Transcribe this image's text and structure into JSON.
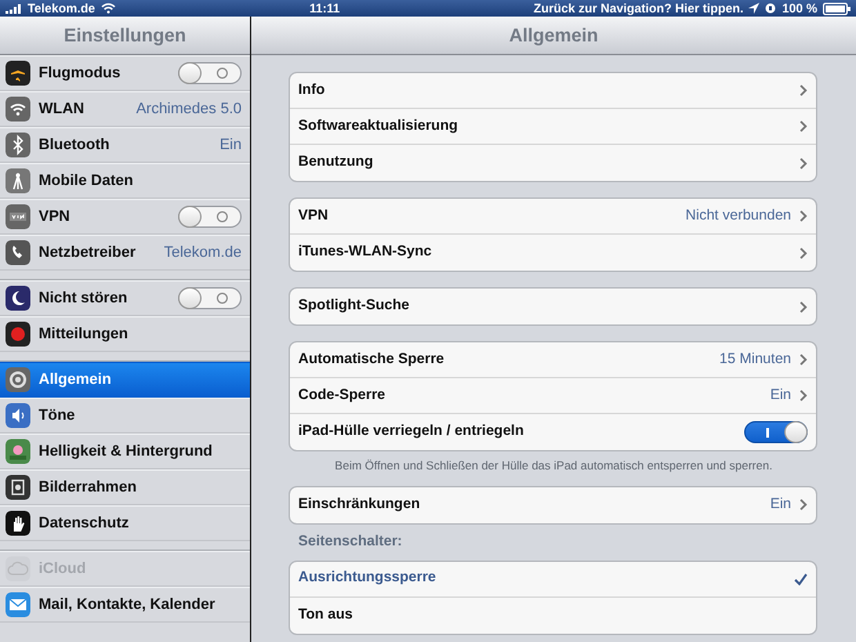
{
  "status_bar": {
    "carrier": "Telekom.de",
    "time": "11:11",
    "back_hint": "Zurück zur Navigation? Hier tippen.",
    "battery": "100 %"
  },
  "sidebar": {
    "title": "Einstellungen",
    "groups": [
      [
        {
          "label": "Flugmodus",
          "kind": "toggle",
          "on": false,
          "selected": false,
          "disabled": false
        },
        {
          "label": "WLAN",
          "kind": "value",
          "value": "Archimedes 5.0",
          "selected": false,
          "disabled": false
        },
        {
          "label": "Bluetooth",
          "kind": "value",
          "value": "Ein",
          "selected": false,
          "disabled": false
        },
        {
          "label": "Mobile Daten",
          "kind": "plain",
          "selected": false,
          "disabled": false
        },
        {
          "label": "VPN",
          "kind": "toggle",
          "on": false,
          "selected": false,
          "disabled": false
        },
        {
          "label": "Netzbetreiber",
          "kind": "value",
          "value": "Telekom.de",
          "selected": false,
          "disabled": false
        }
      ],
      [
        {
          "label": "Nicht stören",
          "kind": "toggle",
          "on": false,
          "selected": false,
          "disabled": false
        },
        {
          "label": "Mitteilungen",
          "kind": "plain",
          "selected": false,
          "disabled": false
        }
      ],
      [
        {
          "label": "Allgemein",
          "kind": "plain",
          "selected": true,
          "disabled": false
        },
        {
          "label": "Töne",
          "kind": "plain",
          "selected": false,
          "disabled": false
        },
        {
          "label": "Helligkeit & Hintergrund",
          "kind": "plain",
          "selected": false,
          "disabled": false
        },
        {
          "label": "Bilderrahmen",
          "kind": "plain",
          "selected": false,
          "disabled": false
        },
        {
          "label": "Datenschutz",
          "kind": "plain",
          "selected": false,
          "disabled": false
        }
      ],
      [
        {
          "label": "iCloud",
          "kind": "plain",
          "selected": false,
          "disabled": true
        },
        {
          "label": "Mail, Kontakte, Kalender",
          "kind": "plain",
          "selected": false,
          "disabled": false
        }
      ]
    ]
  },
  "detail": {
    "title": "Allgemein",
    "groups": [
      {
        "rows": [
          {
            "label": "Info",
            "kind": "link"
          },
          {
            "label": "Softwareaktualisierung",
            "kind": "link"
          },
          {
            "label": "Benutzung",
            "kind": "link"
          }
        ]
      },
      {
        "rows": [
          {
            "label": "VPN",
            "kind": "link",
            "value": "Nicht verbunden"
          },
          {
            "label": "iTunes-WLAN-Sync",
            "kind": "link"
          }
        ]
      },
      {
        "rows": [
          {
            "label": "Spotlight-Suche",
            "kind": "link"
          }
        ]
      },
      {
        "rows": [
          {
            "label": "Automatische Sperre",
            "kind": "link",
            "value": "15 Minuten"
          },
          {
            "label": "Code-Sperre",
            "kind": "link",
            "value": "Ein"
          },
          {
            "label": "iPad-Hülle verriegeln / entriegeln",
            "kind": "toggle",
            "on": true
          }
        ],
        "footer": "Beim Öffnen und Schließen der Hülle das iPad automatisch entsperren und sperren."
      },
      {
        "rows": [
          {
            "label": "Einschränkungen",
            "kind": "link",
            "value": "Ein"
          }
        ]
      },
      {
        "header": "Seitenschalter:",
        "rows": [
          {
            "label": "Ausrichtungssperre",
            "kind": "choice",
            "selected": true
          },
          {
            "label": "Ton aus",
            "kind": "choice",
            "selected": false
          }
        ]
      }
    ]
  }
}
